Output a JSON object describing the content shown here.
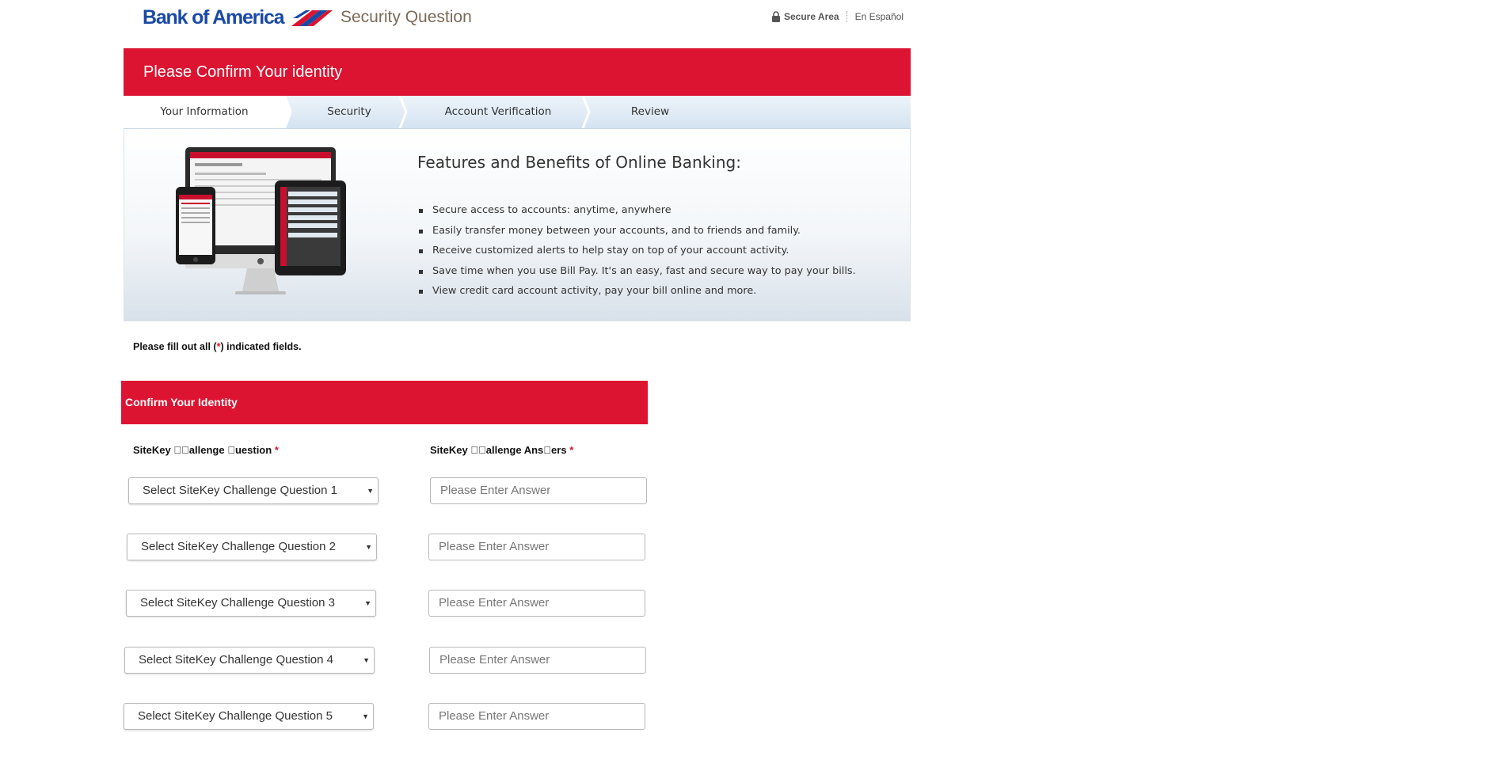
{
  "header": {
    "brand": "Bank of America",
    "page_title": "Security Question",
    "secure_label": "Secure Area",
    "language_link": "En Español"
  },
  "banner": {
    "title": "Please Confirm Your identity"
  },
  "steps": [
    {
      "label": "Your Information",
      "active": true
    },
    {
      "label": "Security",
      "active": false
    },
    {
      "label": "Account Verification",
      "active": false
    },
    {
      "label": "Review",
      "active": false
    }
  ],
  "features": {
    "title": "Features and Benefits of Online Banking:",
    "items": [
      "Secure access to accounts: anytime, anywhere",
      "Easily transfer money between your accounts, and to friends and family.",
      "Receive customized alerts to help stay on top of your account activity.",
      "Save time when you use Bill Pay. It's an easy, fast and secure way to pay your bills.",
      "View credit card account activity, pay your bill online and more."
    ]
  },
  "form": {
    "note_prefix": "Please fill out all (",
    "note_star": "*",
    "note_suffix": ") indicated fields.",
    "section_title": "Confirm Your Identity",
    "question_header": "SiteKey \u0000\u0000allenge \u0000uestion",
    "answer_header": "SiteKey \u0000\u0000allenge Ans\u0000ers",
    "required_mark": "*",
    "questions": [
      "Select SiteKey Challenge Question 1",
      "Select SiteKey Challenge Question 2",
      "Select SiteKey Challenge Question 3",
      "Select SiteKey Challenge Question 4",
      "Select SiteKey Challenge Question 5"
    ],
    "answer_placeholder": "Please Enter Answer"
  },
  "colors": {
    "brand_red": "#dc1431",
    "brand_blue": "#1a4aa6"
  }
}
